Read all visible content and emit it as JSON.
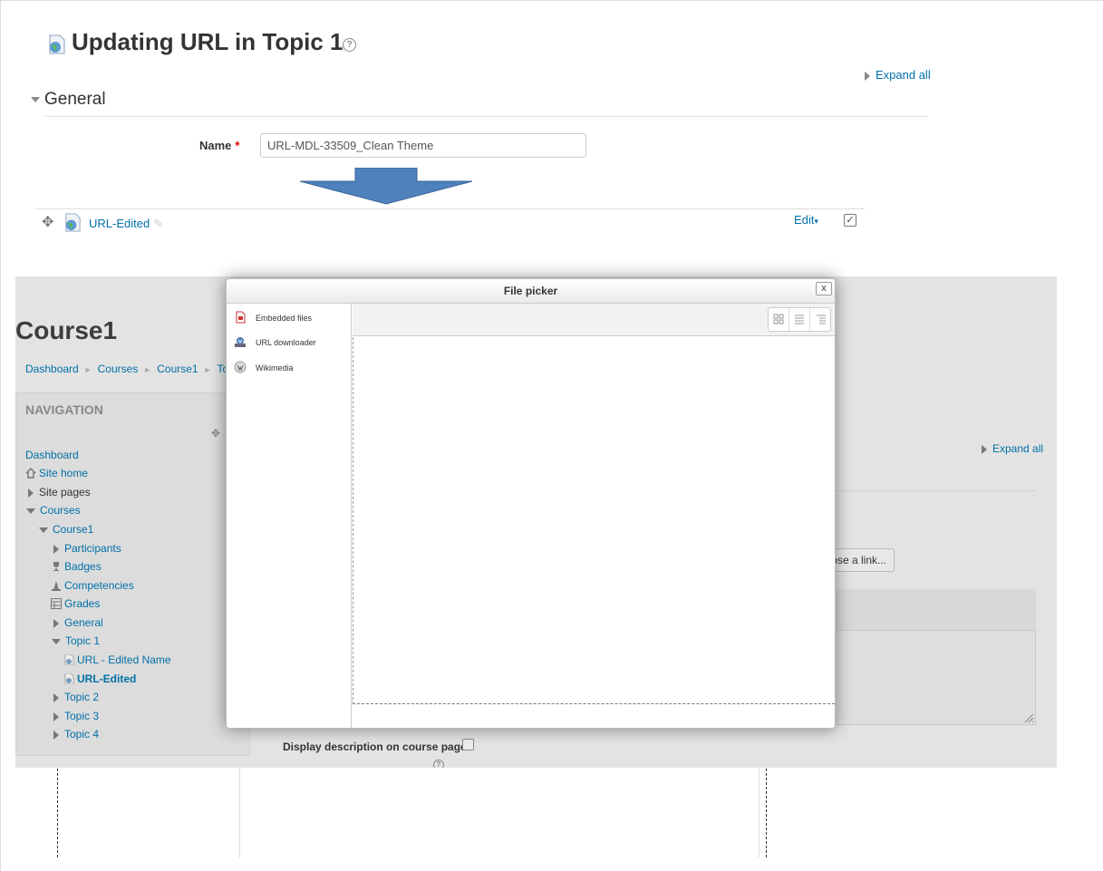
{
  "top": {
    "title": "Updating URL in Topic 1",
    "help": "?",
    "expand_all": "Expand all",
    "section_general": "General",
    "name_label": "Name",
    "required_mark": "*",
    "name_value": "URL-MDL-33509_Clean Theme",
    "activity_name": "URL-Edited",
    "edit_menu": "Edit",
    "edit_caret": "▾",
    "checkmark": "✓",
    "arrow_color": "#4f81bd"
  },
  "lower": {
    "course_title": "Course1",
    "breadcrumb": [
      "Dashboard",
      "Courses",
      "Course1",
      "Topi"
    ],
    "breadcrumb_sep": "►",
    "navigation_header": "NAVIGATION",
    "nav": {
      "dashboard": "Dashboard",
      "site_home": "Site home",
      "site_pages": "Site pages",
      "courses": "Courses",
      "course1": "Course1",
      "participants": "Participants",
      "badges": "Badges",
      "competencies": "Competencies",
      "grades": "Grades",
      "general": "General",
      "topic1": "Topic 1",
      "url_edited_name": "URL - Edited Name",
      "url_edited": "URL-Edited",
      "topic2": "Topic 2",
      "topic3": "Topic 3",
      "topic4": "Topic 4"
    },
    "expand_all": "Expand all",
    "choose_link": "ose a link...",
    "display_description": "Display description on course page",
    "help": "?"
  },
  "file_picker": {
    "title": "File picker",
    "close": "x",
    "repositories": [
      "Embedded files",
      "URL downloader",
      "Wikimedia"
    ]
  }
}
